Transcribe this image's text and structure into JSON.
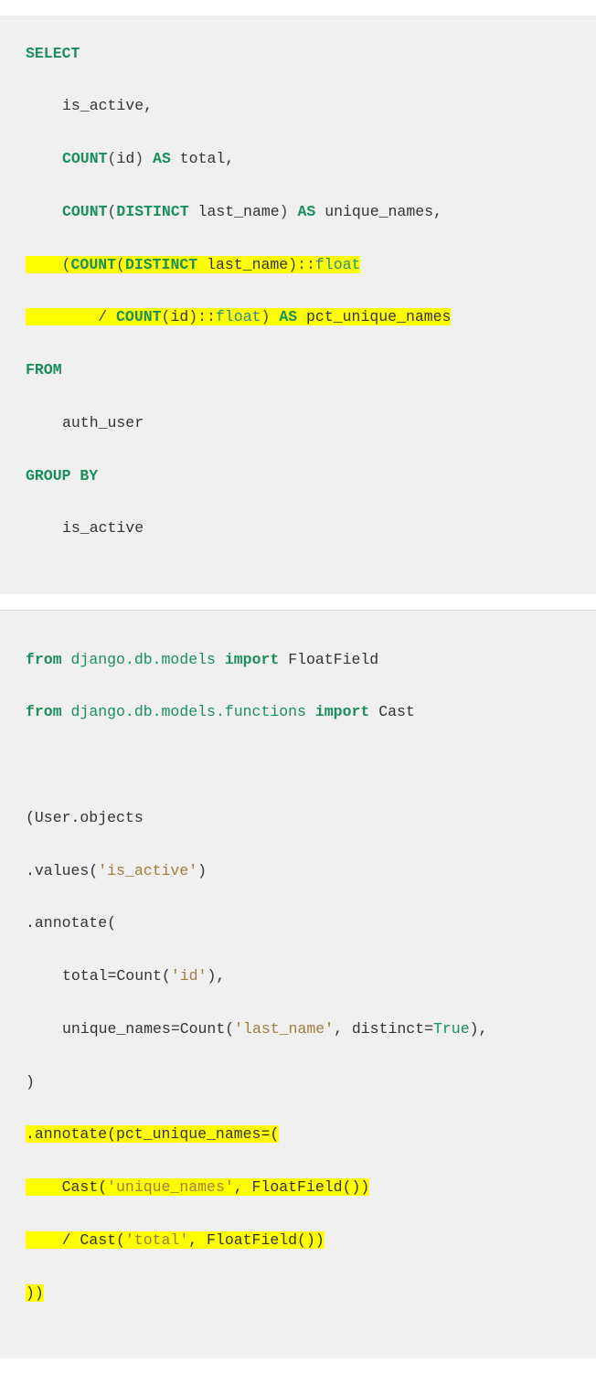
{
  "sql": {
    "select": "SELECT",
    "is_active": "is_active,",
    "count": "COUNT",
    "id": "id",
    "as": "AS",
    "total": "total,",
    "distinct": "DISTINCT",
    "last_name": "last_name",
    "unique_names": "unique_names,",
    "float": "float",
    "pct_unique_names": "pct_unique_names",
    "from": "FROM",
    "auth_user": "auth_user",
    "group_by": "GROUP BY",
    "is_active_plain": "is_active"
  },
  "py": {
    "from": "from",
    "import": "import",
    "mod_models": "django.db.models",
    "mod_functions": "django.db.models.functions",
    "FloatField": "FloatField",
    "Cast": "Cast",
    "user_objects": "(User.objects",
    "values": ".values(",
    "is_active": "'is_active'",
    "close_paren": ")",
    "annotate": ".annotate(",
    "total_eq": "total=Count(",
    "id": "'id'",
    "close_comma": "),",
    "unique_eq": "unique_names=Count(",
    "last_name": "'last_name'",
    "distinct_eq": ", distinct=",
    "true": "True",
    "rparen": ")",
    "annotate2": ".annotate(pct_unique_names=(",
    "cast_unique": "Cast(",
    "unique_names": "'unique_names'",
    "ff_call": ", FloatField())",
    "div": "/ Cast(",
    "total_str": "'total'",
    "ff_call2": ", FloatField())",
    "close2": "))"
  }
}
